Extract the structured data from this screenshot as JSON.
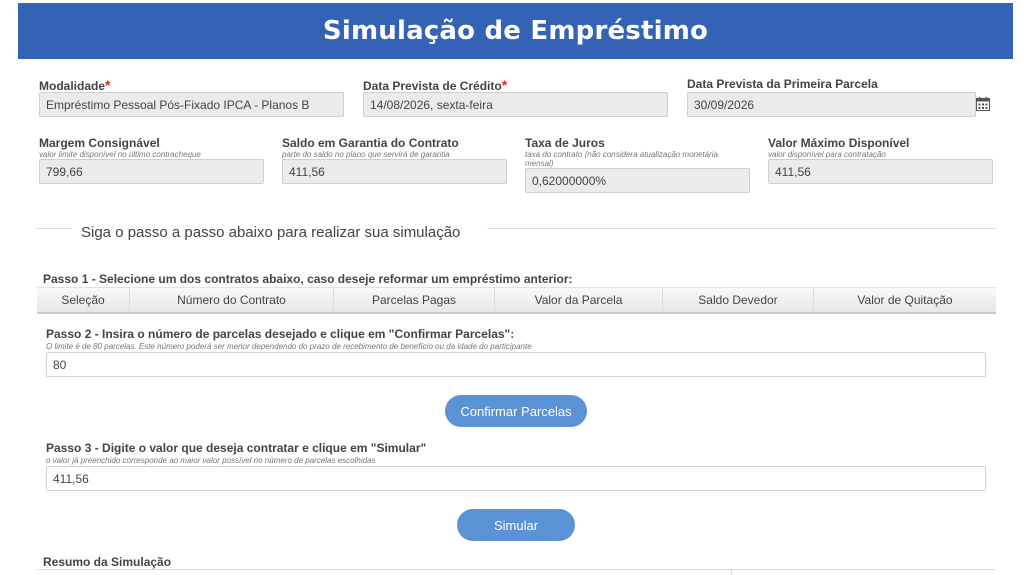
{
  "page": {
    "title": "Simulação de Empréstimo"
  },
  "fields": {
    "modalidade": {
      "label": "Modalidade",
      "value": "Empréstimo Pessoal Pós-Fixado IPCA - Planos B"
    },
    "data_credito": {
      "label": "Data Prevista de Crédito",
      "value": "14/08/2026, sexta-feira"
    },
    "data_parcela": {
      "label": "Data Prevista da Primeira Parcela",
      "value": "30/09/2026"
    },
    "margem": {
      "label": "Margem Consignável",
      "sub": "valor limite disponível no último contracheque",
      "value": "799,66"
    },
    "saldo_garantia": {
      "label": "Saldo em Garantia do Contrato",
      "sub": "parte do saldo no plano que servirá de garantia",
      "value": "411,56"
    },
    "taxa": {
      "label": "Taxa de Juros",
      "sub": "taxa do contrato (não considera atualização monetária mensal)",
      "value": "0,62000000%"
    },
    "valor_maximo": {
      "label": "Valor Máximo Disponível",
      "sub": "valor disponível para contratação",
      "value": "411,56"
    }
  },
  "required_mark": "*",
  "section_title": "Siga o passo a passo abaixo para realizar sua simulação",
  "passo1": {
    "label": "Passo 1 - Selecione um dos contratos abaixo, caso deseje reformar um empréstimo anterior:",
    "columns": [
      "Seleção",
      "Número do Contrato",
      "Parcelas Pagas",
      "Valor da Parcela",
      "Saldo Devedor",
      "Valor de Quitação"
    ]
  },
  "passo2": {
    "label": "Passo 2 - Insira o número de parcelas desejado e clique em \"Confirmar Parcelas\":",
    "sub": "O limite é de 80 parcelas. Este número poderá ser menor dependendo do prazo de recebimento de benefício ou da idade do participante",
    "value": "80",
    "button": "Confirmar Parcelas"
  },
  "passo3": {
    "label": "Passo 3 - Digite o valor que deseja contratar e clique em \"Simular\"",
    "sub": "o valor já preenchido corresponde ao maior valor possível no número de parcelas escolhidas",
    "value": "411,56",
    "button": "Simular"
  },
  "resumo": {
    "label": "Resumo da Simulação"
  },
  "icons": {
    "date_picker": "calendar-icon"
  },
  "colors": {
    "header": "#3463b5",
    "button": "#5b92d6",
    "required": "#e5231e"
  }
}
